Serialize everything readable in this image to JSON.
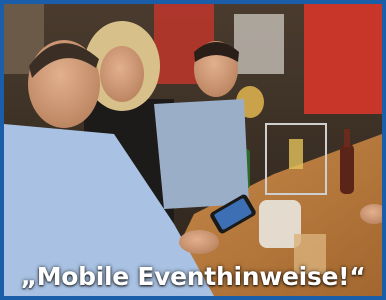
{
  "caption": "„Mobile Eventhinweise!“",
  "colors": {
    "frame_border": "#1a5da9",
    "caption_text": "#ffffff",
    "table_wood": "#b8793f"
  }
}
